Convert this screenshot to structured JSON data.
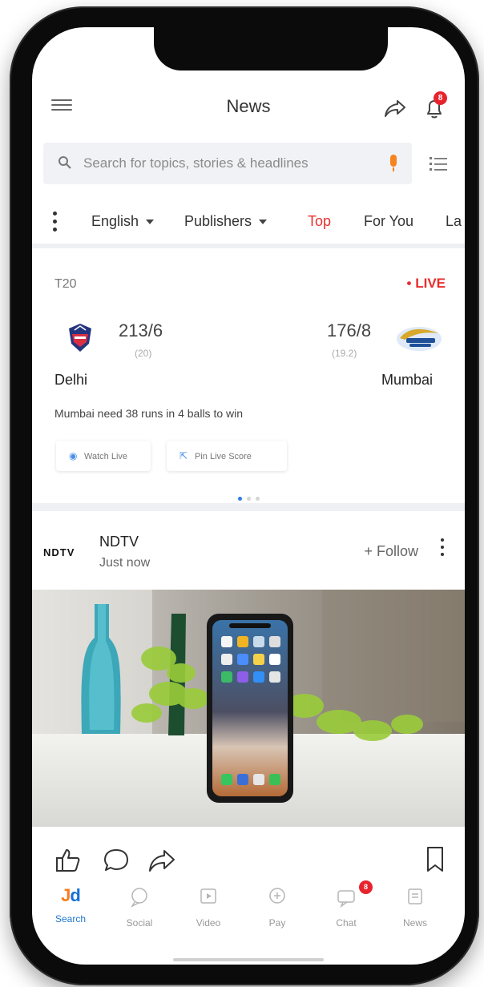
{
  "header": {
    "title": "News",
    "notification_count": "8"
  },
  "search": {
    "placeholder": "Search for topics, stories & headlines"
  },
  "filters": {
    "language": "English",
    "publishers": "Publishers",
    "tabs": [
      "Top",
      "For You",
      "La"
    ],
    "active_tab": "Top"
  },
  "score_card": {
    "match_type": "T20",
    "live_label": "• LIVE",
    "team_left": {
      "name": "Delhi",
      "score": "213/6",
      "overs": "(20)"
    },
    "team_right": {
      "name": "Mumbai",
      "score": "176/8",
      "overs": "(19.2)"
    },
    "status": "Mumbai need 38 runs in 4 balls to win",
    "buttons": {
      "watch_live": "Watch Live",
      "pin_live_score": "Pin Live Score"
    },
    "pager": {
      "count": 3,
      "active_index": 0
    }
  },
  "news": {
    "publisher_logo": "NDTV",
    "publisher_name": "NDTV",
    "time": "Just now",
    "follow_label": "+ Follow"
  },
  "bottom_nav": {
    "items": [
      {
        "label": "Search"
      },
      {
        "label": "Social"
      },
      {
        "label": "Video"
      },
      {
        "label": "Pay"
      },
      {
        "label": "Chat"
      },
      {
        "label": "News"
      }
    ],
    "active_index": 0,
    "chat_badge": "8"
  },
  "colors": {
    "accent_red": "#e7312d",
    "accent_blue": "#1f77cf",
    "jd_orange": "#f57d1f",
    "jd_blue": "#1672d6"
  }
}
